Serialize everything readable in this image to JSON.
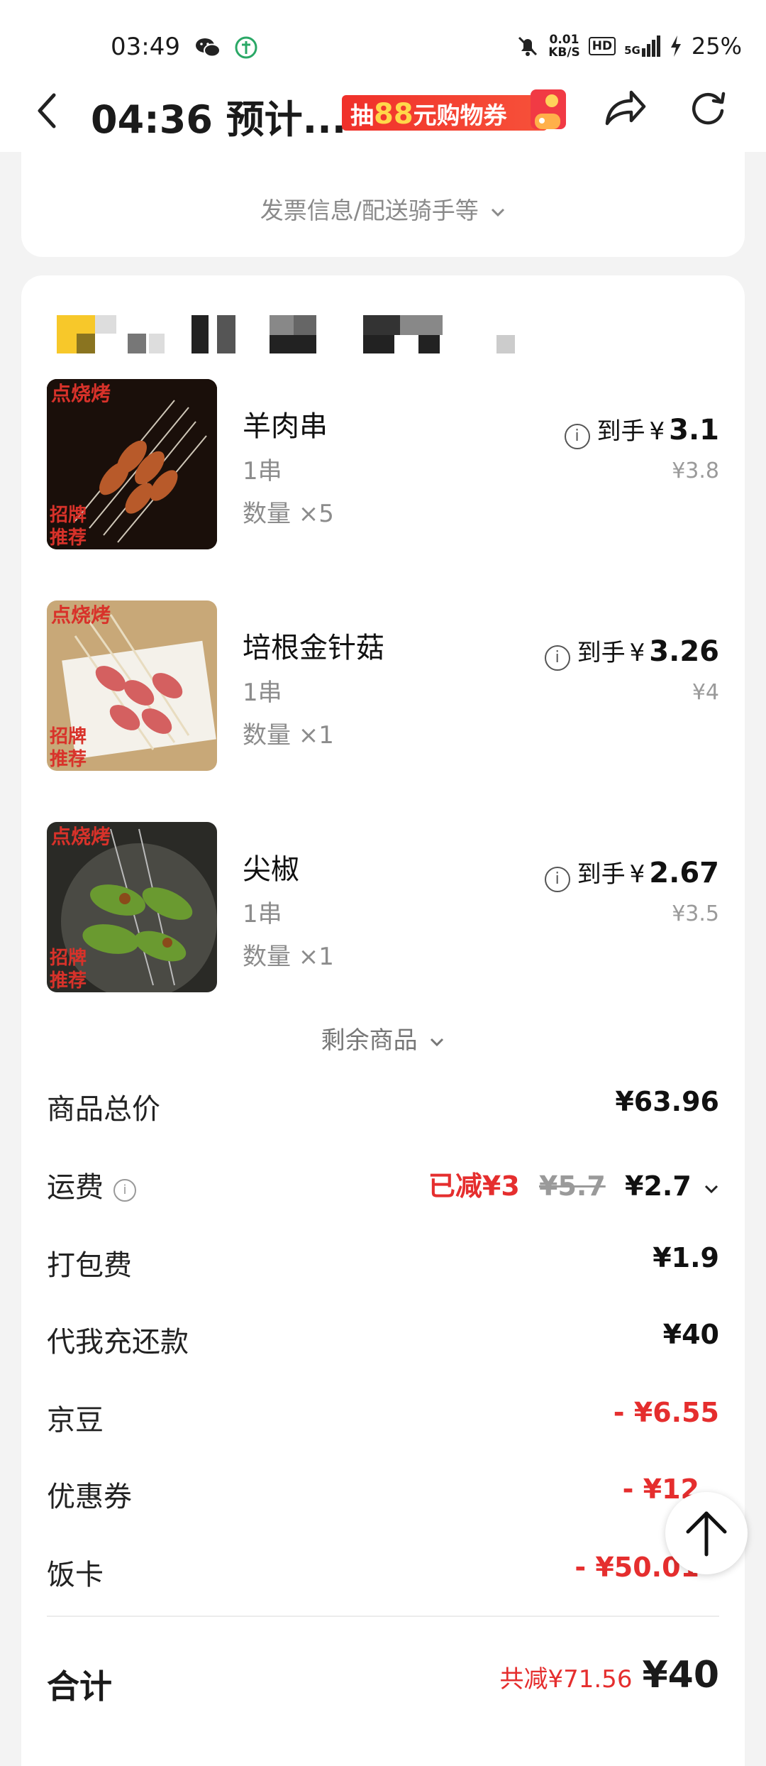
{
  "status_bar": {
    "time": "03:49",
    "net_speed": "0.01",
    "net_unit": "KB/S",
    "hd": "HD",
    "signal": "5G",
    "battery": "25%"
  },
  "nav": {
    "title": "04:36 预计...",
    "promo_prefix": "抽",
    "promo_amount": "88",
    "promo_suffix": "元购物券"
  },
  "invoice_toggle": "发票信息/配送骑手等",
  "items": [
    {
      "name": "羊肉串",
      "spec": "1串",
      "qty": "数量 ×5",
      "price_label": "到手",
      "currency": "¥",
      "price": "3.1",
      "orig_price": "¥3.8"
    },
    {
      "name": "培根金针菇",
      "spec": "1串",
      "qty": "数量 ×1",
      "price_label": "到手",
      "currency": "¥",
      "price": "3.26",
      "orig_price": "¥4"
    },
    {
      "name": "尖椒",
      "spec": "1串",
      "qty": "数量 ×1",
      "price_label": "到手",
      "currency": "¥",
      "price": "2.67",
      "orig_price": "¥3.5"
    }
  ],
  "remaining_items": "剩余商品",
  "costs": {
    "goods_total": {
      "label": "商品总价",
      "value": "¥63.96"
    },
    "delivery": {
      "label": "运费",
      "discount": "已减¥3",
      "original": "¥5.7",
      "value": "¥2.7"
    },
    "packing": {
      "label": "打包费",
      "value": "¥1.9"
    },
    "topup": {
      "label": "代我充还款",
      "value": "¥40"
    },
    "jingdou": {
      "label": "京豆",
      "value": "- ¥6.55"
    },
    "coupon": {
      "label": "优惠券",
      "value": "- ¥12"
    },
    "meal_card": {
      "label": "饭卡",
      "value": "- ¥50.01"
    }
  },
  "total": {
    "label": "合计",
    "saved": "共减¥71.56",
    "value": "¥40"
  },
  "colors": {
    "accent_red": "#e52e2e",
    "promo_red": "#f0302a",
    "promo_yellow": "#ffd84a"
  }
}
